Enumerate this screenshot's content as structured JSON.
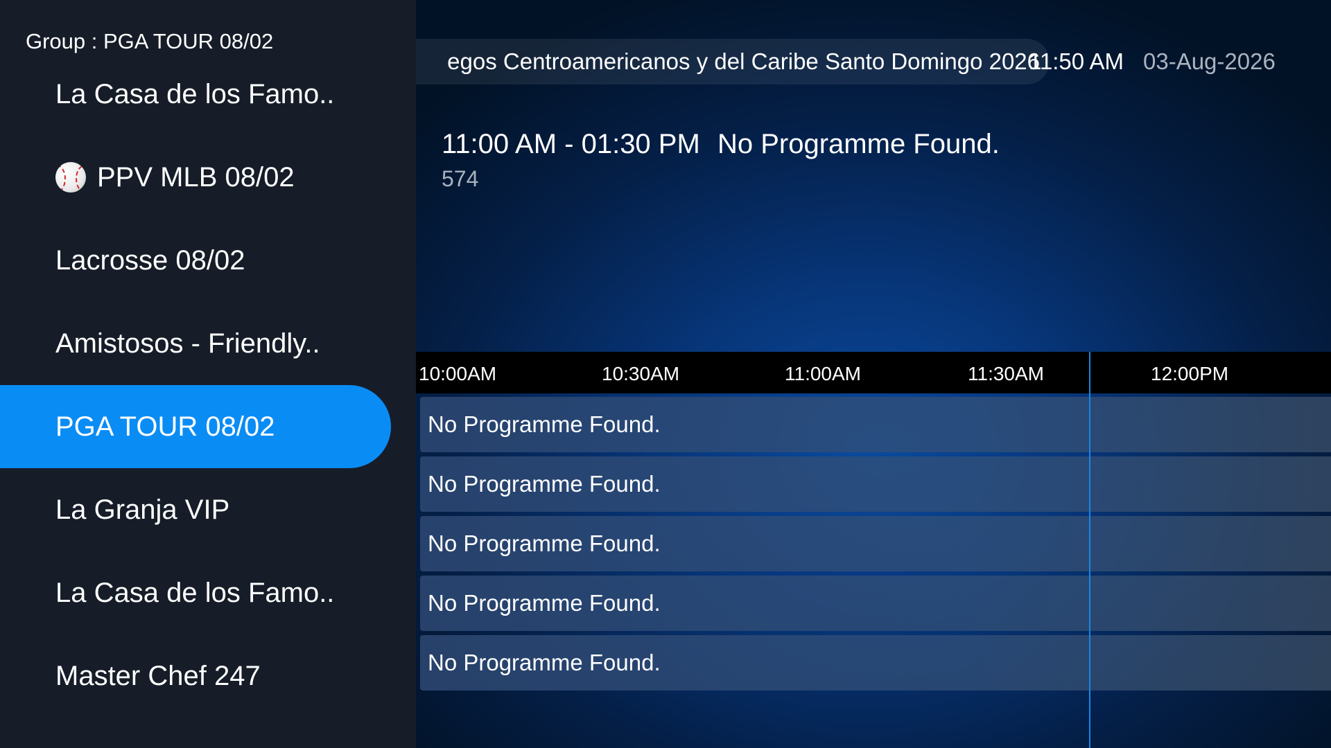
{
  "sidebar": {
    "group_title": "Group : PGA TOUR 08/02",
    "items": [
      {
        "label": "La Casa de los Famo..",
        "icon": "",
        "active": false
      },
      {
        "label": "PPV MLB 08/02",
        "icon": "baseball-icon",
        "active": false
      },
      {
        "label": "Lacrosse 08/02",
        "icon": "",
        "active": false
      },
      {
        "label": "Amistosos - Friendly..",
        "icon": "",
        "active": false
      },
      {
        "label": "PGA TOUR 08/02",
        "icon": "",
        "active": true
      },
      {
        "label": "La Granja VIP",
        "icon": "",
        "active": false
      },
      {
        "label": "La Casa de los Famo..",
        "icon": "",
        "active": false
      },
      {
        "label": "Master Chef 247",
        "icon": "",
        "active": false
      }
    ]
  },
  "header": {
    "ticker": "egos Centroamericanos y del Caribe Santo Domingo 2026",
    "clock": "11:50 AM",
    "date": "03-Aug-2026"
  },
  "current_programme": {
    "time_range": "11:00 AM - 01:30 PM",
    "title": "No Programme Found.",
    "channel_number": "574"
  },
  "timeline": {
    "labels": [
      "10:00AM",
      "10:30AM",
      "11:00AM",
      "11:30AM",
      "12:00PM"
    ]
  },
  "programme_rows": [
    {
      "title": "No Programme Found."
    },
    {
      "title": "No Programme Found."
    },
    {
      "title": "No Programme Found."
    },
    {
      "title": "No Programme Found."
    },
    {
      "title": "No Programme Found."
    }
  ],
  "colors": {
    "sidebar_bg": "#161d28",
    "active_item": "#0a8cf5",
    "now_line": "#1a86e6"
  }
}
